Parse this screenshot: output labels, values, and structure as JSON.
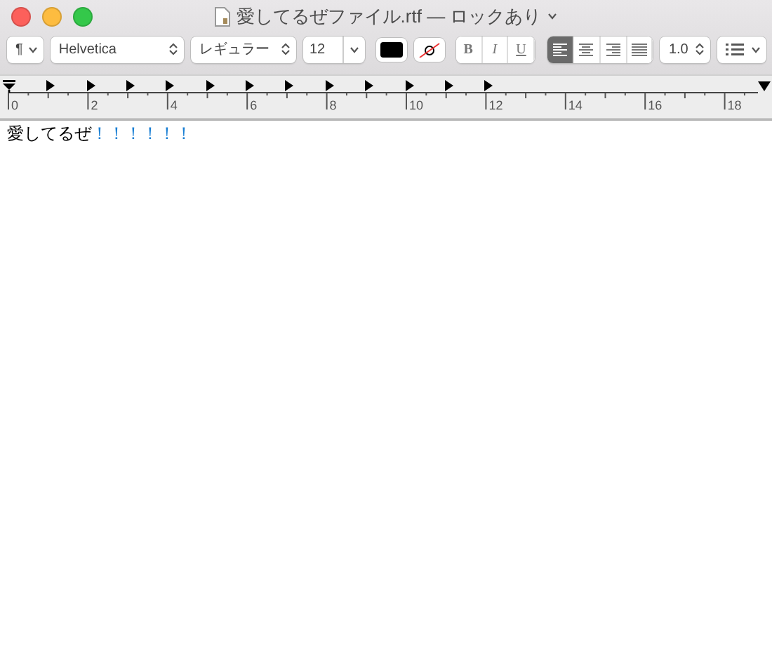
{
  "window": {
    "title": "愛してるぜファイル.rtf — ロックあり"
  },
  "toolbar": {
    "paragraph_style": "¶",
    "font": "Helvetica",
    "typeface": "レギュラー",
    "size": "12",
    "styles": [
      {
        "label": "B",
        "kind": "bold"
      },
      {
        "label": "I",
        "kind": "italic"
      },
      {
        "label": "U",
        "kind": "underline"
      }
    ],
    "alignment": [
      {
        "kind": "left",
        "selected": true
      },
      {
        "kind": "center",
        "selected": false
      },
      {
        "kind": "right",
        "selected": false
      },
      {
        "kind": "justify",
        "selected": false
      }
    ],
    "line_spacing": "1.0"
  },
  "ruler": {
    "labels": [
      "0",
      "2",
      "4",
      "6",
      "8",
      "10",
      "12",
      "14",
      "16",
      "18"
    ]
  },
  "document": {
    "segments": [
      {
        "text": "愛してるぜ",
        "color": "#000000"
      },
      {
        "text": "！！！！！！",
        "color": "#1a7fd4"
      }
    ]
  }
}
